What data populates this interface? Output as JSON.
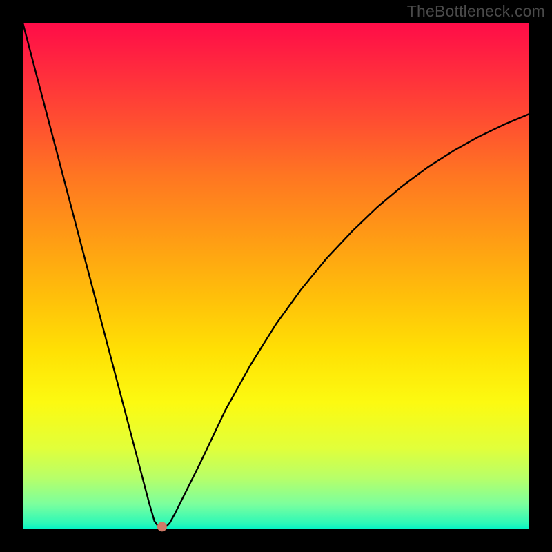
{
  "watermark": "TheBottleneck.com",
  "chart_data": {
    "type": "line",
    "title": "",
    "xlabel": "",
    "ylabel": "",
    "xlim": [
      0,
      100
    ],
    "ylim": [
      0,
      100
    ],
    "series": [
      {
        "name": "bottleneck-curve",
        "x": [
          0,
          2,
          4,
          6,
          8,
          10,
          12,
          14,
          16,
          18,
          20,
          22,
          24,
          25,
          26,
          27,
          27.5,
          28,
          28.5,
          29,
          30,
          32,
          35,
          40,
          45,
          50,
          55,
          60,
          65,
          70,
          75,
          80,
          85,
          90,
          95,
          100
        ],
        "y": [
          100,
          92.4,
          84.8,
          77.2,
          69.6,
          62,
          54.4,
          46.8,
          39.2,
          31.6,
          24,
          16.4,
          8.8,
          5,
          1.6,
          0.2,
          0,
          0.3,
          0.7,
          1.2,
          3,
          7,
          13,
          23.5,
          32.5,
          40.5,
          47.4,
          53.5,
          58.8,
          63.6,
          67.8,
          71.5,
          74.7,
          77.5,
          79.9,
          82
        ]
      }
    ],
    "marker": {
      "x": 27.5,
      "y": 0.5,
      "color": "#cf7a67",
      "radius": 7
    }
  }
}
